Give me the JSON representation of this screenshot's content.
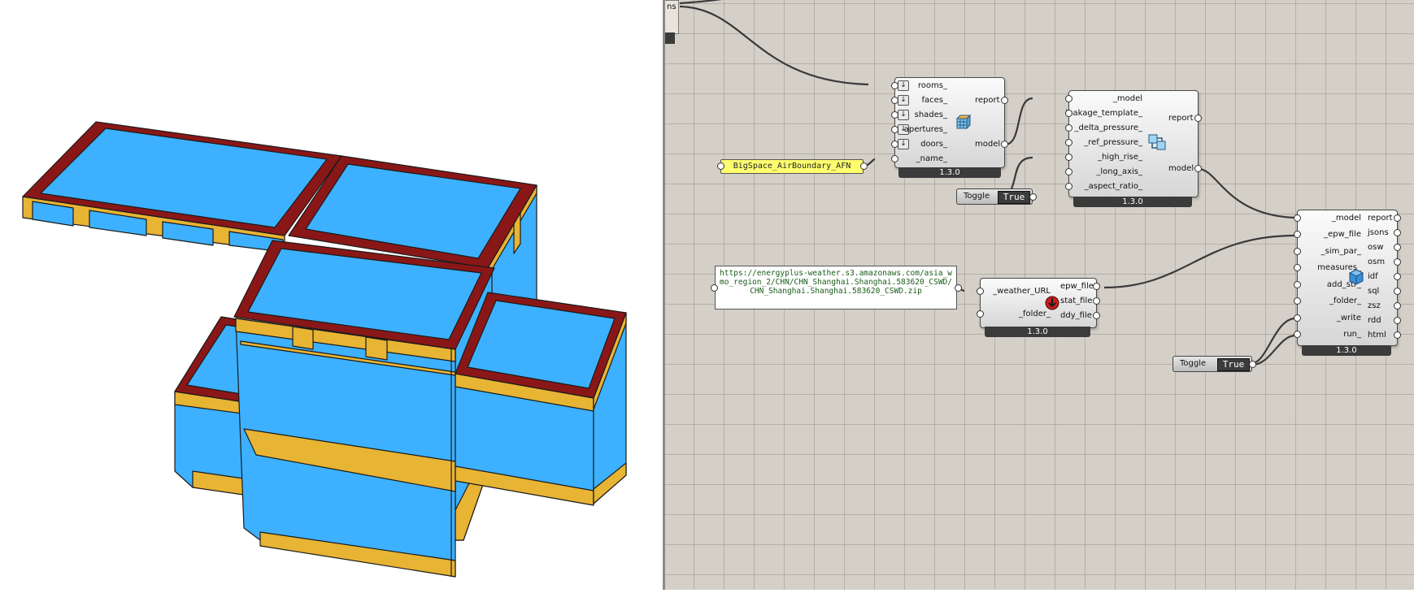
{
  "viewport": {
    "description_label": ""
  },
  "canvas": {
    "edge_component": {
      "label": "ns"
    },
    "create_model": {
      "inputs": [
        "rooms_",
        "faces_",
        "shades_",
        "apertures_",
        "doors_",
        "_name_"
      ],
      "outputs": [
        "report",
        "model"
      ],
      "version": "1.3.0",
      "icon": "model-cube-icon"
    },
    "name_panel": {
      "text": "BigSpace_AirBoundary_AFN"
    },
    "afn_component": {
      "inputs": [
        "_model",
        "leakage_template_",
        "_delta_pressure_",
        "_ref_pressure_",
        "_high_rise_",
        "_long_axis_",
        "_aspect_ratio_"
      ],
      "outputs": [
        "report",
        "model"
      ],
      "version": "1.3.0",
      "icon": "afn-network-icon"
    },
    "toggle_1": {
      "label": "Toggle",
      "value": "True"
    },
    "url_panel": {
      "text": "https://energyplus-weather.s3.amazonaws.com/asia_wmo_region_2/CHN/CHN_Shanghai.Shanghai.583620_CSWD/CHN_Shanghai.Shanghai.583620_CSWD.zip"
    },
    "weather_component": {
      "inputs": [
        "_weather_URL",
        "_folder_"
      ],
      "outputs": [
        "epw_file",
        "stat_file",
        "ddy_file"
      ],
      "version": "1.3.0",
      "icon": "weather-download-icon"
    },
    "run_component": {
      "inputs": [
        "_model",
        "_epw_file",
        "_sim_par_",
        "measures_",
        "add_str_",
        "_folder_",
        "_write",
        "run_"
      ],
      "outputs": [
        "report",
        "jsons",
        "osw",
        "osm",
        "idf",
        "sql",
        "zsz",
        "rdd",
        "html"
      ],
      "version": "1.3.0",
      "icon": "openstudio-icon"
    },
    "toggle_2": {
      "label": "Toggle",
      "value": "True"
    }
  },
  "colors": {
    "roof_fill": "#3db1ff",
    "parapet_red": "#8a1717",
    "wall_yellow": "#e8b434",
    "canvas_bg": "#d4d0c8",
    "panel_yellow": "#ffff70"
  }
}
